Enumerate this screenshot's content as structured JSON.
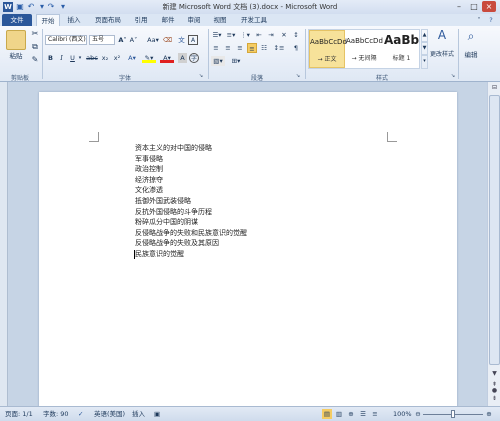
{
  "window": {
    "title": "新建 Microsoft Word 文档 (3).docx - Microsoft Word"
  },
  "tabs": [
    "文件",
    "开始",
    "插入",
    "页面布局",
    "引用",
    "邮件",
    "审阅",
    "视图",
    "开发工具"
  ],
  "clipboard": {
    "paste_label": "粘贴",
    "group_label": "剪贴板"
  },
  "font": {
    "name": "Calibri (西文)",
    "size": "五号",
    "group_label": "字体"
  },
  "paragraph": {
    "group_label": "段落"
  },
  "styles": {
    "items": [
      {
        "sample": "AaBbCcDd",
        "name": "→ 正文"
      },
      {
        "sample": "AaBbCcDd",
        "name": "→ 无间隔"
      },
      {
        "sample": "AaBb",
        "name": "标题 1"
      }
    ],
    "change_label": "更改样式",
    "group_label": "样式"
  },
  "editing": {
    "label": "编辑"
  },
  "document": {
    "lines": [
      "资本主义的对中国的侵略",
      "军事侵略",
      "政治控制",
      "经济掠夺",
      "文化渗透",
      "抵御外国武装侵略",
      "反抗外国侵略的斗争历程",
      "粉碎瓜分中国的阴谋",
      "反侵略战争的失败和民族意识的觉醒",
      "反侵略战争的失败及其原因",
      "民族意识的觉醒"
    ]
  },
  "status": {
    "page": "页面: 1/1",
    "words": "字数: 90",
    "language": "英语(美国)",
    "insert": "插入",
    "zoom": "100%"
  },
  "colors": {
    "file_tab": "#2b579a",
    "highlight": "#ffff00",
    "font_color": "#e02020"
  }
}
